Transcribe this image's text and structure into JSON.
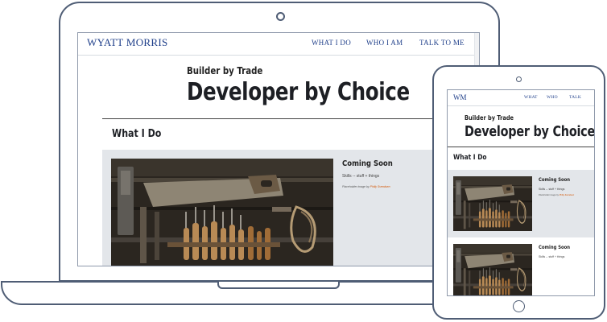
{
  "laptop": {
    "nav": {
      "brand": "WYATT MORRIS",
      "items": [
        "WHAT I DO",
        "WHO I AM",
        "TALK TO ME"
      ]
    },
    "hero": {
      "eyebrow": "Builder by Trade",
      "title": "Developer by Choice"
    },
    "section_title": "What I Do",
    "card": {
      "title": "Coming Soon",
      "body": "Skills -- stuff + things",
      "credit_prefix": "Placeholder image by",
      "credit_name": "Philly Svendsen"
    }
  },
  "tablet": {
    "nav": {
      "brand": "WM",
      "items": [
        "WHAT",
        "WHO",
        "TALK"
      ]
    },
    "hero": {
      "eyebrow": "Builder by Trade",
      "title": "Developer by Choice"
    },
    "section_title": "What I Do",
    "cards": [
      {
        "title": "Coming Soon",
        "body": "Skills -- stuff + things",
        "credit_prefix": "Placeholder image by",
        "credit_name": "Philly Svendsen"
      },
      {
        "title": "Coming Soon",
        "body": "Skills -- stuff + things"
      }
    ]
  }
}
